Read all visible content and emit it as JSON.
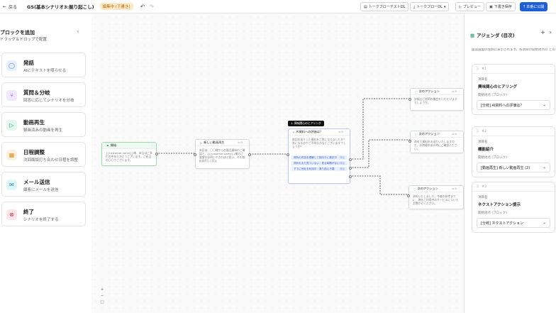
{
  "topbar": {
    "back_label": "戻る",
    "title": "GS(基本シナリオ3:掘り起こし)",
    "badge": "編集中 (下書き)",
    "buttons": {
      "talk_test": "トークフローテストDL",
      "talk_flow": "トークフローDL",
      "preview": "プレビュー",
      "save_draft": "下書き保存",
      "publish": "本番に公開"
    }
  },
  "sidebar": {
    "title": "ブロックを追加",
    "subtitle": "ドラッグ＆ドロップで配置",
    "blocks": [
      {
        "title": "発話",
        "desc": "AIにテキストを喋らせる",
        "icon": "speech-bubble-icon",
        "color": "#3a7bd5",
        "bg": "#e6f0ff"
      },
      {
        "title": "質問＆分岐",
        "desc": "回答に応じてシナリオを分岐",
        "icon": "branch-icon",
        "color": "#8a3fd1",
        "bg": "#f1e7ff"
      },
      {
        "title": "動画再生",
        "desc": "録画済みの動画を再生",
        "icon": "play-icon",
        "color": "#1e9e6a",
        "bg": "#e2f7ee"
      },
      {
        "title": "日程調整",
        "desc": "次回面談打ち合わせ日程を調整",
        "icon": "calendar-icon",
        "color": "#e08a1e",
        "bg": "#fff1df"
      },
      {
        "title": "メール送信",
        "desc": "顧客にメールを送信",
        "icon": "mail-icon",
        "color": "#1e8fb0",
        "bg": "#e0f4fa"
      },
      {
        "title": "終了",
        "desc": "シナリオを終了する",
        "icon": "close-circle-icon",
        "color": "#d83a4a",
        "bg": "#fde6e8"
      }
    ]
  },
  "canvas": {
    "tooltip": "1. 興味関心のヒアリング",
    "nodes": {
      "start": {
        "title": "開始",
        "body": "{{customer.name}}様、本日はご多忙の中ありがとうございます。ご担当の〇〇でございます。"
      },
      "video": {
        "title": "新しい動画再生",
        "body": "本日は、〇〇様からの製品資料のご確認と、{{customer.name}}様のご要望をお伺いできればと思い、その前に動画をご覧いただきます。",
        "tag": "動画再生の設定"
      },
      "question": {
        "title": "AI資料への評価は？",
        "body": "前回お送りした資料をご覧になりましたか？ 気になる点やご不明な点などございますでしょうか？",
        "options": [
          "資料の内容を理解して前向きに検討中",
          "資料をまだ見ていない・見る時間がない",
          "すでに他社を利用中・乗り換え不要"
        ],
        "option_tag": "発話"
      },
      "action1": {
        "title": "次のアクション",
        "body": "詳細なご説明の機会をいただけますでしょうか。"
      },
      "action2": {
        "title": "次のアクション",
        "body": "改めて資料をお送りいたしますので、お時間のある時にご確認ください。"
      },
      "action3": {
        "title": "次のアクション",
        "body": "承知いたしました。今後の参考までに、現在ご利用中のサービスについてお聞かせください。"
      }
    },
    "zoom": [
      "+",
      "−",
      "□"
    ]
  },
  "right_panel": {
    "title": "アジェンダ (目次)",
    "desc": "面談画面の左側に表示されます。各項目が開始地点の どのブロックを選んでください。",
    "item_label": "項目名",
    "start_label": "開始地点 (ブロック)",
    "items": [
      {
        "num": "#1",
        "name": "興味関心のヒアリング",
        "start": "[分岐] AI資料への評価は？"
      },
      {
        "num": "#2",
        "name": "機能紹介",
        "start": "[動画再生] 新しい動画再生 (2)"
      },
      {
        "num": "#3",
        "name": "ネクストアクション提示",
        "start": "[分岐] ネクストアクション"
      }
    ]
  }
}
